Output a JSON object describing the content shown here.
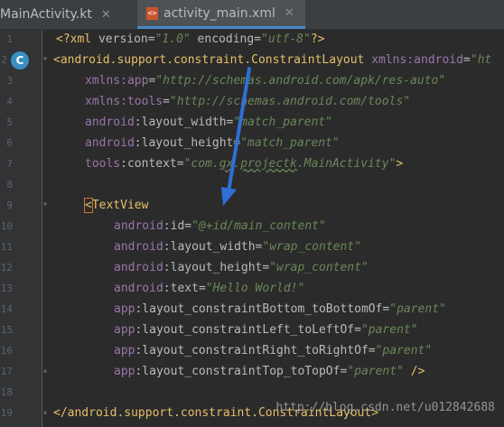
{
  "tabs": [
    {
      "label": "MainActivity.kt",
      "active": false
    },
    {
      "label": "activity_main.xml",
      "active": true,
      "icon_text": "<>"
    }
  ],
  "gutter": {
    "line_numbers": [
      "1",
      "2",
      "3",
      "4",
      "5",
      "6",
      "7",
      "8",
      "9",
      "10",
      "11",
      "12",
      "13",
      "14",
      "15",
      "16",
      "17",
      "18",
      "19"
    ],
    "class_badge": "C"
  },
  "code": {
    "l1": {
      "p1": "<?xml ",
      "p2": "version",
      "p3": "=",
      "p4": "\"1.0\"",
      "p5": " encoding",
      "p6": "=",
      "p7": "\"utf-8\"",
      "p8": "?>"
    },
    "l2": {
      "tag": "<android.support.constraint.ConstraintLayout",
      "ns": " xmlns:android",
      "eq": "=",
      "val": "\"ht"
    },
    "l3": {
      "ns": "xmlns:app",
      "eq": "=",
      "val": "\"http://schemas.android.com/apk/res-auto\""
    },
    "l4": {
      "ns": "xmlns:tools",
      "eq": "=",
      "val": "\"http://schemas.android.com/tools\""
    },
    "l5": {
      "ns": "android",
      "attr": ":layout_width",
      "eq": "=",
      "val": "\"match_parent\""
    },
    "l6": {
      "ns": "android",
      "attr": ":layout_height",
      "eq": "=",
      "val": "\"match_parent\""
    },
    "l7": {
      "ns": "tools",
      "attr": ":context",
      "eq": "=",
      "val_a": "\"com.",
      "val_b": "gx",
      "val_c": ".",
      "val_d": "projectk",
      "val_e": ".MainActivity\"",
      "close": ">"
    },
    "l9": {
      "tag_open": "<",
      "tag_name": "TextView"
    },
    "l10": {
      "ns": "android",
      "attr": ":id",
      "eq": "=",
      "val": "\"@+id/main_content\""
    },
    "l11": {
      "ns": "android",
      "attr": ":layout_width",
      "eq": "=",
      "val": "\"wrap_content\""
    },
    "l12": {
      "ns": "android",
      "attr": ":layout_height",
      "eq": "=",
      "val": "\"wrap_content\""
    },
    "l13": {
      "ns": "android",
      "attr": ":text",
      "eq": "=",
      "val": "\"Hello World!\""
    },
    "l14": {
      "ns": "app",
      "attr": ":layout_constraintBottom_toBottomOf",
      "eq": "=",
      "val": "\"parent\""
    },
    "l15": {
      "ns": "app",
      "attr": ":layout_constraintLeft_toLeftOf",
      "eq": "=",
      "val": "\"parent\""
    },
    "l16": {
      "ns": "app",
      "attr": ":layout_constraintRight_toRightOf",
      "eq": "=",
      "val": "\"parent\""
    },
    "l17": {
      "ns": "app",
      "attr": ":layout_constraintTop_toTopOf",
      "eq": "=",
      "val": "\"parent\"",
      "close": " />"
    },
    "l19": {
      "tag": "</android.support.constraint.ConstraintLayout",
      "close": ">"
    }
  },
  "watermark": "http://blog.csdn.net/u012842688",
  "colors": {
    "background": "#2b2b2b",
    "tag": "#e8bf6a",
    "namespace": "#9876aa",
    "string": "#6a8759",
    "annotation_arrow": "#2f6fd6"
  }
}
